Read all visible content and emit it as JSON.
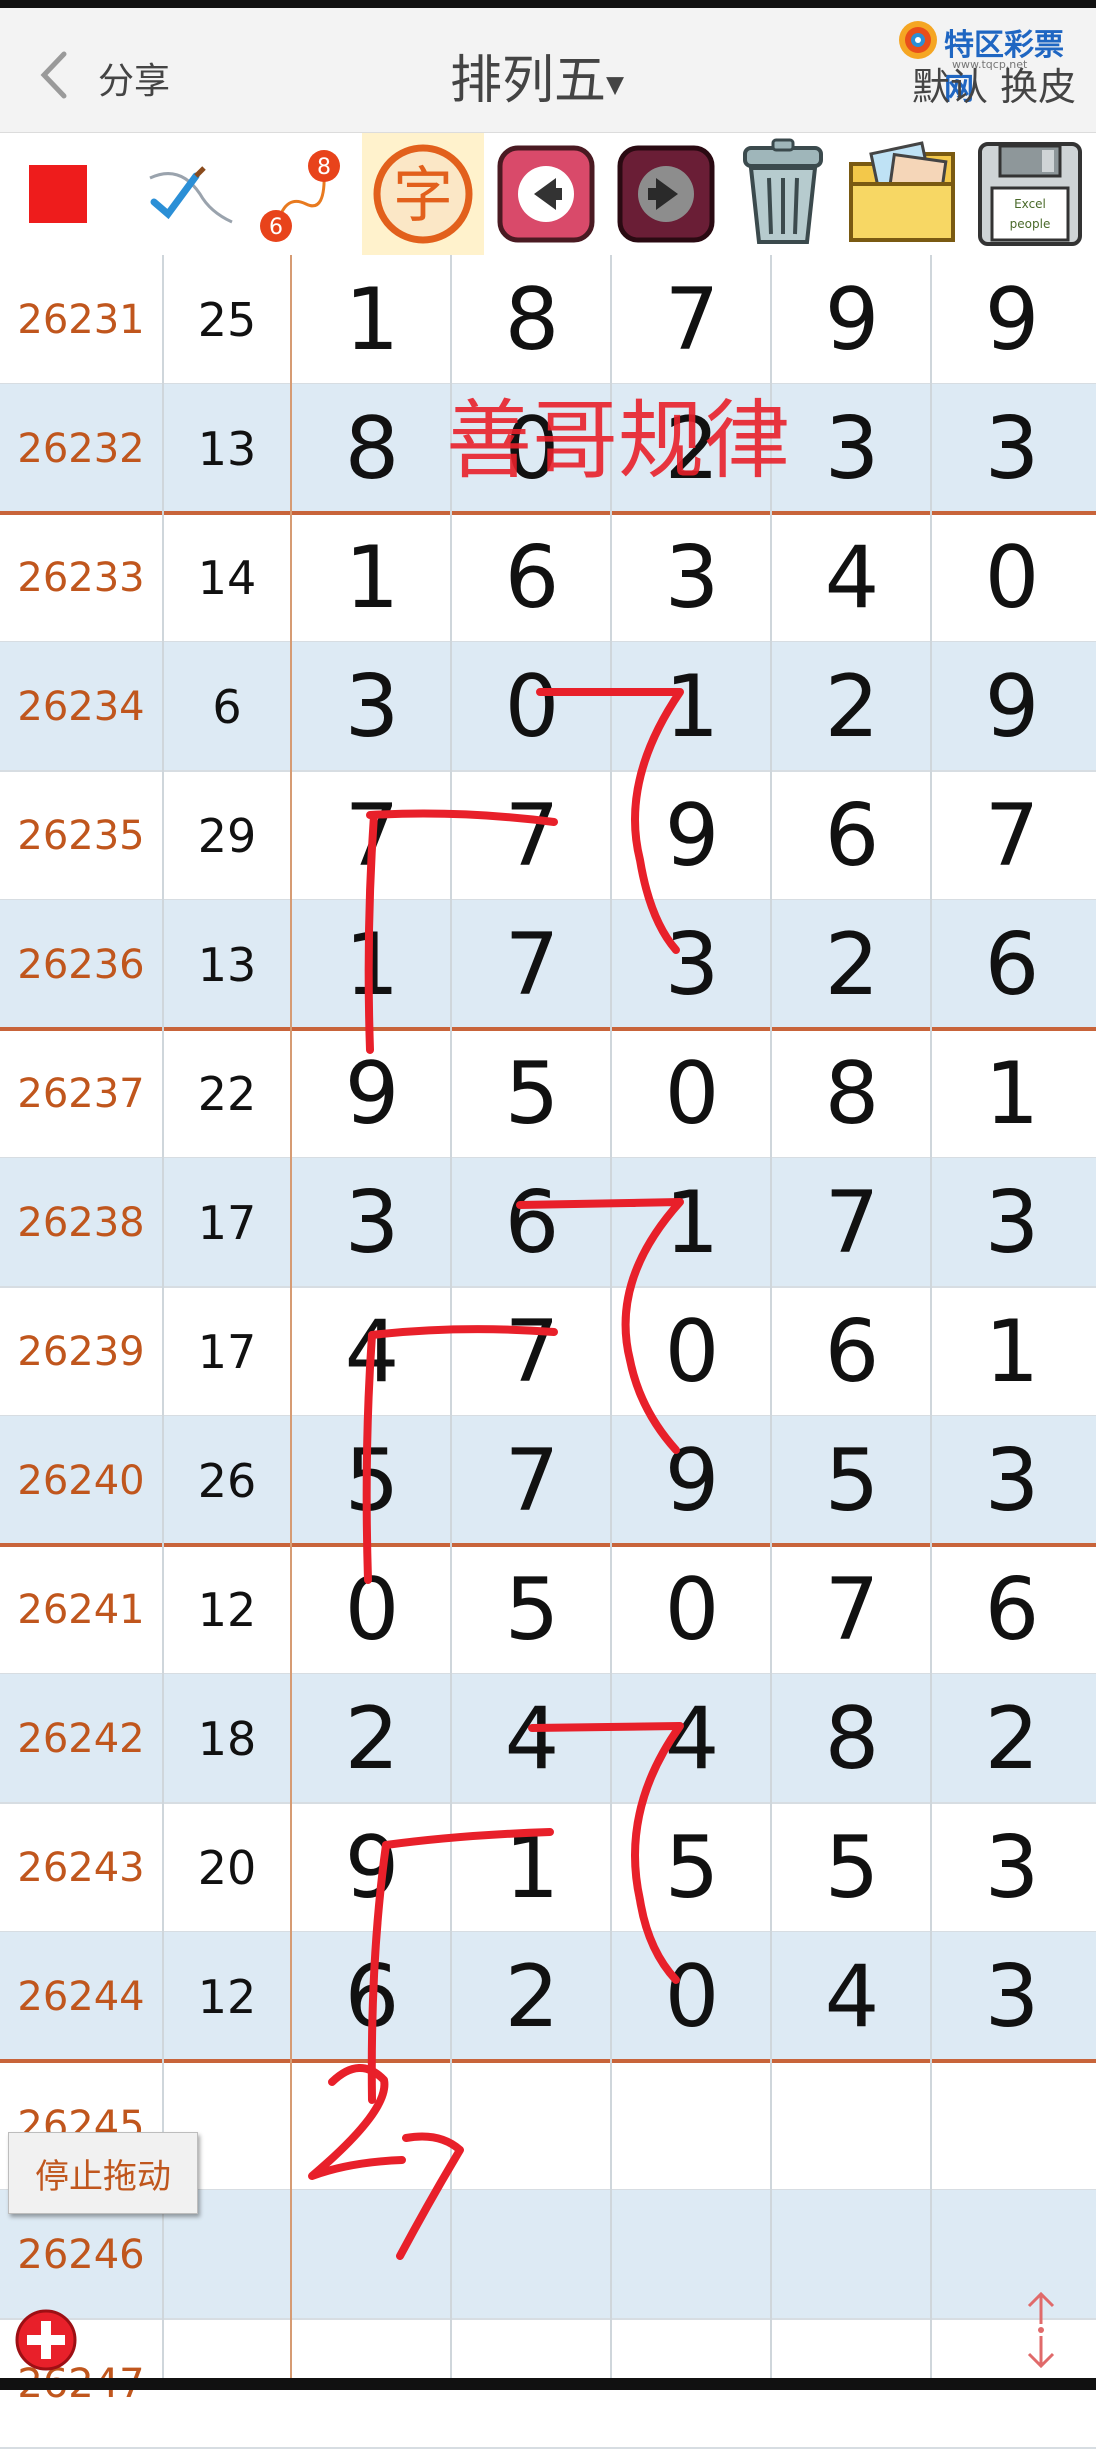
{
  "header": {
    "share_label": "分享",
    "title": "排列五",
    "title_caret": "▾",
    "skin_label": "默认 换皮",
    "logo_text": "特区彩票网",
    "logo_sub": "www.tqcp.net"
  },
  "toolbar": {
    "icons": [
      "red-square-icon",
      "pen-check-icon",
      "route-6-8-icon",
      "zi-character-icon",
      "back-arrow-icon",
      "forward-arrow-icon",
      "trash-icon",
      "photo-folder-icon",
      "floppy-save-icon"
    ],
    "route_label_top": "8",
    "route_label_bottom": "6",
    "zi_label": "字",
    "save_label_top": "Excel",
    "save_label_bottom": "people"
  },
  "rows": [
    {
      "issue": "26231",
      "sum": "25",
      "digits": [
        "1",
        "8",
        "7",
        "9",
        "9"
      ]
    },
    {
      "issue": "26232",
      "sum": "13",
      "digits": [
        "8",
        "0",
        "2",
        "3",
        "3"
      ]
    },
    {
      "issue": "26233",
      "sum": "14",
      "digits": [
        "1",
        "6",
        "3",
        "4",
        "0"
      ]
    },
    {
      "issue": "26234",
      "sum": "6",
      "digits": [
        "3",
        "0",
        "1",
        "2",
        "9"
      ]
    },
    {
      "issue": "26235",
      "sum": "29",
      "digits": [
        "7",
        "7",
        "9",
        "6",
        "7"
      ]
    },
    {
      "issue": "26236",
      "sum": "13",
      "digits": [
        "1",
        "7",
        "3",
        "2",
        "6"
      ]
    },
    {
      "issue": "26237",
      "sum": "22",
      "digits": [
        "9",
        "5",
        "0",
        "8",
        "1"
      ]
    },
    {
      "issue": "26238",
      "sum": "17",
      "digits": [
        "3",
        "6",
        "1",
        "7",
        "3"
      ]
    },
    {
      "issue": "26239",
      "sum": "17",
      "digits": [
        "4",
        "7",
        "0",
        "6",
        "1"
      ]
    },
    {
      "issue": "26240",
      "sum": "26",
      "digits": [
        "5",
        "7",
        "9",
        "5",
        "3"
      ]
    },
    {
      "issue": "26241",
      "sum": "12",
      "digits": [
        "0",
        "5",
        "0",
        "7",
        "6"
      ]
    },
    {
      "issue": "26242",
      "sum": "18",
      "digits": [
        "2",
        "4",
        "4",
        "8",
        "2"
      ]
    },
    {
      "issue": "26243",
      "sum": "20",
      "digits": [
        "9",
        "1",
        "5",
        "5",
        "3"
      ]
    },
    {
      "issue": "26244",
      "sum": "12",
      "digits": [
        "6",
        "2",
        "0",
        "4",
        "3"
      ]
    },
    {
      "issue": "26245",
      "sum": "",
      "digits": [
        "",
        "",
        "",
        "",
        ""
      ]
    },
    {
      "issue": "26246",
      "sum": "",
      "digits": [
        "",
        "",
        "",
        "",
        ""
      ]
    },
    {
      "issue": "26247",
      "sum": "",
      "digits": [
        "",
        "",
        "",
        "",
        ""
      ]
    }
  ],
  "annotation": {
    "watermark": "善哥规律",
    "handwritten_prediction": "27",
    "ink_color": "#e8202a"
  },
  "controls": {
    "stop_drag_label": "停止拖动"
  },
  "colors": {
    "issue_text": "#c0561d",
    "alt_row": "#ddeaf4",
    "group_line": "#c8643a"
  }
}
